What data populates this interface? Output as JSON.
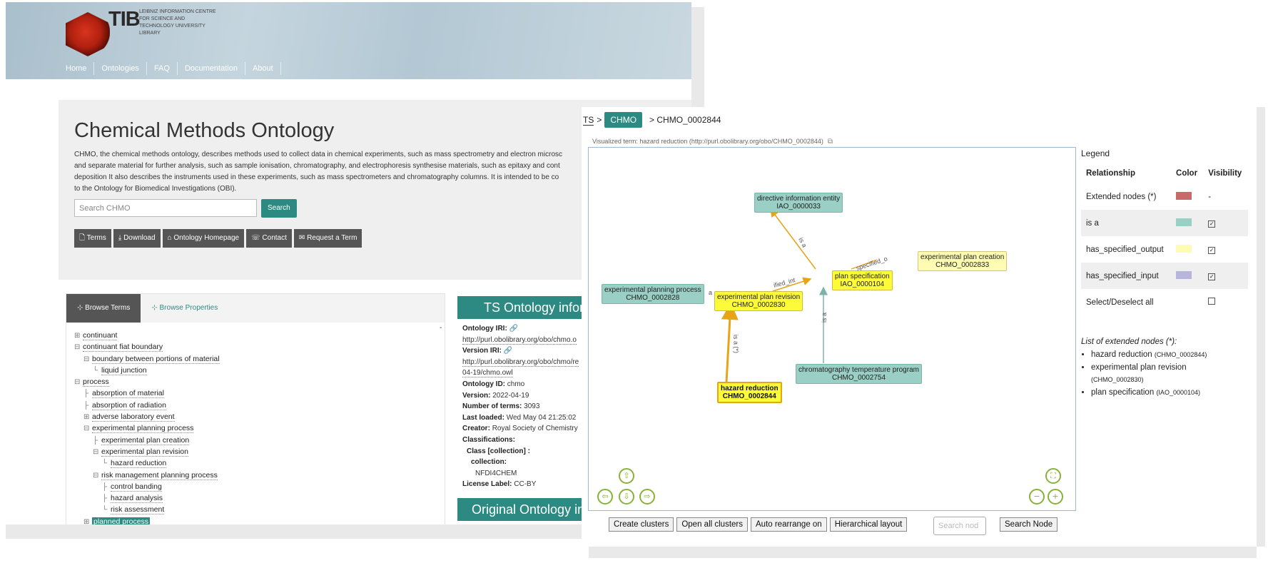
{
  "header": {
    "logo_text": "TIB",
    "logo_sub": "LEIBNIZ INFORMATION CENTRE FOR SCIENCE AND TECHNOLOGY UNIVERSITY LIBRARY",
    "nav": [
      "Home",
      "Ontologies",
      "FAQ",
      "Documentation",
      "About"
    ]
  },
  "ontology": {
    "title": "Chemical Methods Ontology",
    "description_lines": [
      "CHMO, the chemical methods ontology, describes methods used to collect data in chemical experiments, such as mass spectrometry and electron microsc",
      "and separate material for further analysis, such as sample ionisation, chromatography, and electrophoresis synthesise materials, such as epitaxy and cont",
      "deposition It also describes the instruments used in these experiments, such as mass spectrometers and chromatography columns. It is intended to be co",
      "to the Ontology for Biomedical Investigations (OBI)."
    ],
    "search_placeholder": "Search CHMO",
    "search_button": "Search",
    "actions": [
      "Terms",
      "Download",
      "Ontology Homepage",
      "Contact",
      "Request a Term"
    ]
  },
  "browse": {
    "tabs": [
      "Browse Terms",
      "Browse Properties"
    ],
    "collapse_symbol": "-",
    "tree": [
      {
        "label": "continuant",
        "symbol": "⊞",
        "depth": 0
      },
      {
        "label": "continuant fiat boundary",
        "symbol": "⊟",
        "depth": 0
      },
      {
        "label": "boundary between portions of material",
        "symbol": "⊟",
        "depth": 1
      },
      {
        "label": "liquid junction",
        "symbol": "└",
        "depth": 2
      },
      {
        "label": "process",
        "symbol": "⊟",
        "depth": 0
      },
      {
        "label": "absorption of material",
        "symbol": "├",
        "depth": 1
      },
      {
        "label": "absorption of radiation",
        "symbol": "├",
        "depth": 1
      },
      {
        "label": "adverse laboratory event",
        "symbol": "⊞",
        "depth": 1
      },
      {
        "label": "experimental planning process",
        "symbol": "⊟",
        "depth": 1
      },
      {
        "label": "experimental plan creation",
        "symbol": "├",
        "depth": 2
      },
      {
        "label": "experimental plan revision",
        "symbol": "⊟",
        "depth": 2
      },
      {
        "label": "hazard reduction",
        "symbol": "└",
        "depth": 3
      },
      {
        "label": "risk management planning process",
        "symbol": "⊟",
        "depth": 2
      },
      {
        "label": "control banding",
        "symbol": "├",
        "depth": 3
      },
      {
        "label": "hazard analysis",
        "symbol": "├",
        "depth": 3
      },
      {
        "label": "risk assessment",
        "symbol": "└",
        "depth": 3
      },
      {
        "label": "planned process",
        "symbol": "⊞",
        "depth": 1,
        "selected": true
      }
    ]
  },
  "info": {
    "title": "TS Ontology inform",
    "iri_label": "Ontology IRI:",
    "iri_value": "http://purl.obolibrary.org/obo/chmo.o",
    "version_iri_label": "Version IRI:",
    "version_iri_line1": "http://purl.obolibrary.org/obo/chmo/re",
    "version_iri_line2": "04-19/chmo.owl",
    "id_label": "Ontology ID:",
    "id_value": "chmo",
    "version_label": "Version:",
    "version_value": "2022-04-19",
    "terms_label": "Number of terms:",
    "terms_value": "3093",
    "loaded_label": "Last loaded:",
    "loaded_value": "Wed May 04 21:25:02",
    "creator_label": "Creator:",
    "creator_value": "Royal Society of Chemistry",
    "class_label": "Classifications:",
    "class_collection": "Class [collection] :",
    "collection_label": "collection:",
    "collection_value": "NFDI4CHEM",
    "license_label": "License Label:",
    "license_value": "CC-BY",
    "title2": "Original Ontology info"
  },
  "graph": {
    "breadcrumb": {
      "ts": "TS",
      "sep": ">",
      "chmo": "CHMO",
      "term": "> CHMO_0002844"
    },
    "visualized_term": "Visualized term: hazard reduction (http://purl.obolibrary.org/obo/CHMO_0002844)",
    "nodes": {
      "directive": {
        "name": "directive information entity",
        "id": "IAO_0000033"
      },
      "creation": {
        "name": "experimental plan creation",
        "id": "CHMO_0002833"
      },
      "planning": {
        "name": "experimental planning process",
        "id": "CHMO_0002828"
      },
      "plan_spec": {
        "name": "plan specification",
        "id": "IAO_0000104"
      },
      "revision": {
        "name": "experimental plan revision",
        "id": "CHMO_0002830"
      },
      "chromatography": {
        "name": "chromatography temperature program",
        "id": "CHMO_0002754"
      },
      "hazard": {
        "name": "hazard reduction",
        "id": "CHMO_0002844"
      }
    },
    "edge_labels": {
      "is_a": "is a",
      "is_a_ext": "is a (*)",
      "specified_out": "specified_o",
      "specified_int": "ified_int",
      "a_partial": "a"
    },
    "nav_icons": [
      "arrow-up-icon",
      "arrow-left-icon",
      "arrow-down-icon",
      "arrow-right-icon",
      "fit-icon",
      "zoom-out-icon",
      "zoom-in-icon"
    ],
    "buttons": [
      "Create clusters",
      "Open all clusters",
      "Auto rearrange on",
      "Hierarchical layout"
    ],
    "search_placeholder": "Search nod",
    "search_button": "Search Node"
  },
  "legend": {
    "title": "Legend",
    "headers": [
      "Relationship",
      "Color",
      "Visibility"
    ],
    "rows": [
      {
        "name": "Extended nodes (*)",
        "color": "#c96a6a",
        "visibility": "-"
      },
      {
        "name": "is a",
        "color": "#99cfc4",
        "visibility": "☑"
      },
      {
        "name": "has_specified_output",
        "color": "#fdfcb2",
        "visibility": "☑"
      },
      {
        "name": "has_specified_input",
        "color": "#b8b5dc",
        "visibility": "☑"
      },
      {
        "name": "Select/Deselect all",
        "color": "",
        "visibility": "☐"
      }
    ],
    "ext_title": "List of extended nodes (*):",
    "ext_nodes": [
      {
        "name": "hazard reduction",
        "id": "(CHMO_0002844)"
      },
      {
        "name": "experimental plan revision",
        "id": "(CHMO_0002830)"
      },
      {
        "name": "plan specification",
        "id": "(IAO_0000104)"
      }
    ]
  }
}
